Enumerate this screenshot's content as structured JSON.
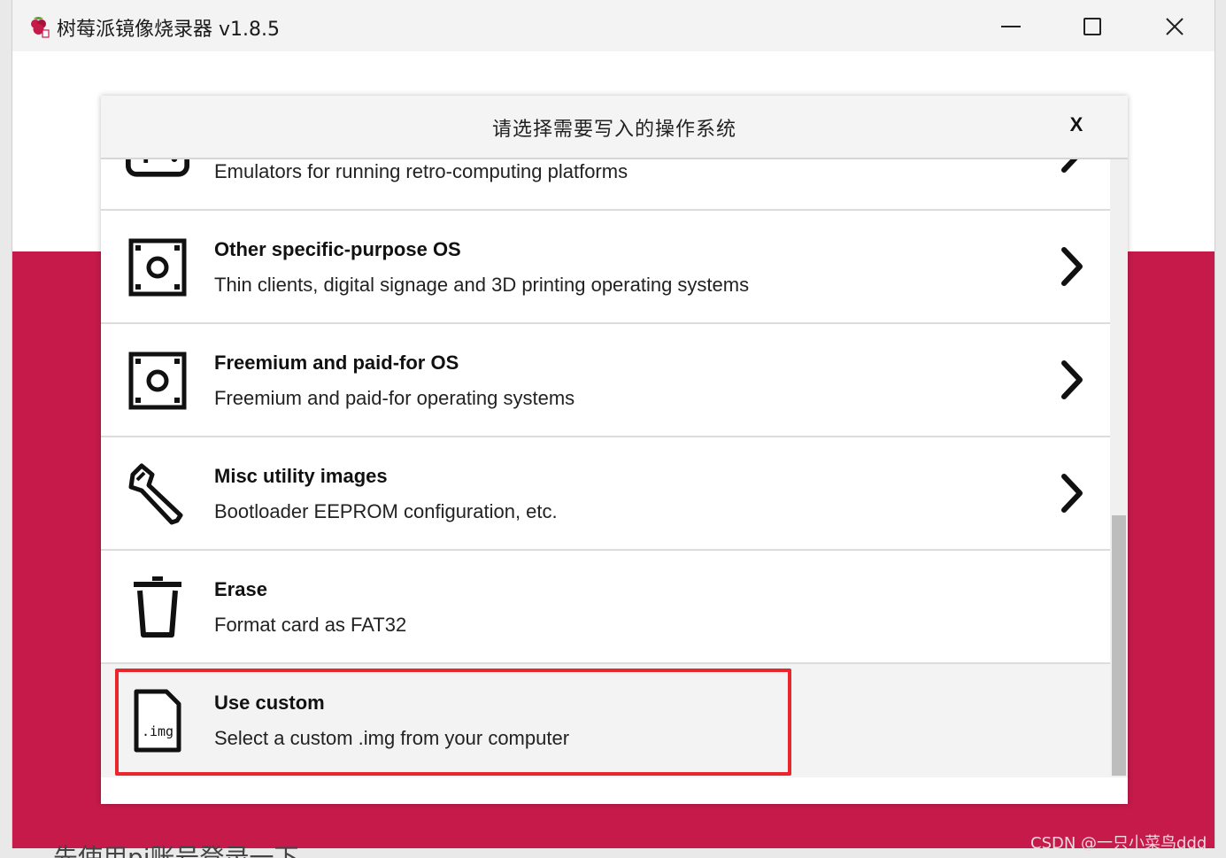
{
  "window": {
    "title": "树莓派镜像烧录器 v1.8.5",
    "minimize_icon": "minimize-icon",
    "maximize_icon": "maximize-icon",
    "close_icon": "close-icon"
  },
  "background": {
    "partial_text": "先使用pi账号登录一下",
    "upper_color": "#ffffff",
    "lower_color": "#c51a4a"
  },
  "dialog": {
    "title": "请选择需要写入的操作系统",
    "close_label": "X",
    "items": [
      {
        "name": "",
        "desc": "Emulators for running retro-computing platforms",
        "icon": "gamepad-icon",
        "has_chevron": true
      },
      {
        "name": "Other specific-purpose OS",
        "desc": "Thin clients, digital signage and 3D printing operating systems",
        "icon": "os-box-icon",
        "has_chevron": true
      },
      {
        "name": "Freemium and paid-for OS",
        "desc": "Freemium and paid-for operating systems",
        "icon": "os-box-icon",
        "has_chevron": true
      },
      {
        "name": "Misc utility images",
        "desc": "Bootloader EEPROM configuration, etc.",
        "icon": "wrench-icon",
        "has_chevron": true
      },
      {
        "name": "Erase",
        "desc": "Format card as FAT32",
        "icon": "trash-icon",
        "has_chevron": false
      },
      {
        "name": "Use custom",
        "desc": "Select a custom .img from your computer",
        "icon": "img-file-icon",
        "icon_label": ".img",
        "has_chevron": false,
        "highlighted": true
      }
    ]
  },
  "annotation": {
    "color": "#e8262b"
  },
  "watermark": "CSDN @一只小菜鸟ddd"
}
